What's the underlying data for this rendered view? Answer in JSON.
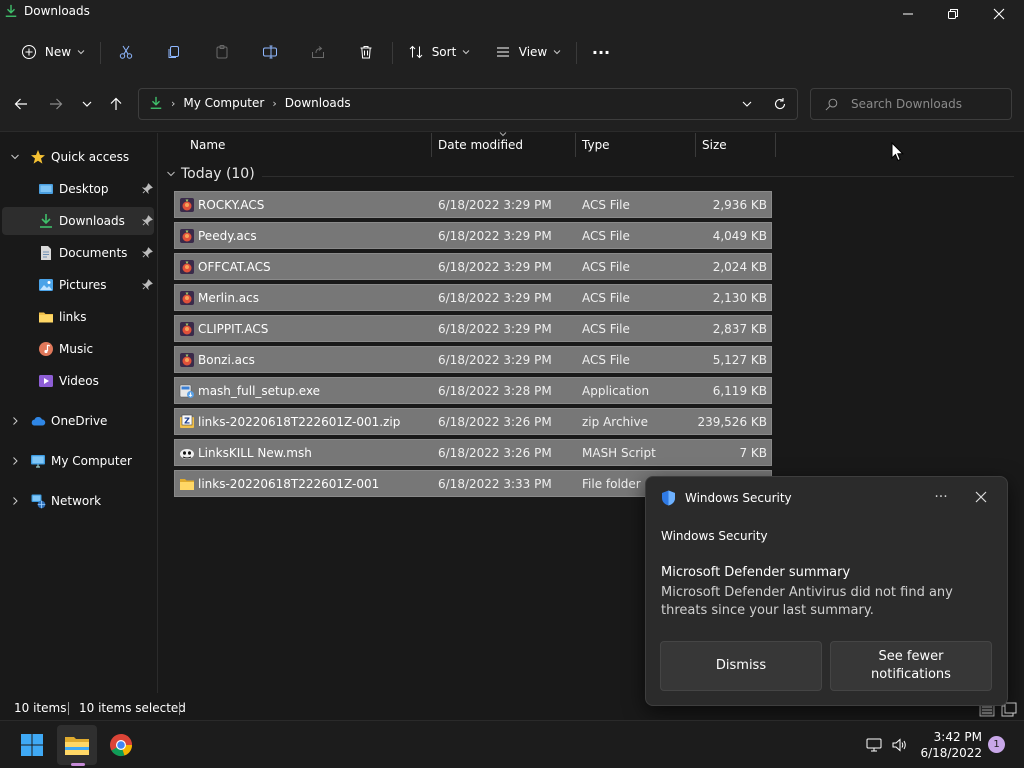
{
  "window": {
    "title": "Downloads"
  },
  "toolbar": {
    "new_label": "New",
    "sort_label": "Sort",
    "view_label": "View",
    "more_label": "···"
  },
  "address": {
    "crumbs": [
      "My Computer",
      "Downloads"
    ]
  },
  "search": {
    "placeholder": "Search Downloads"
  },
  "sidebar": {
    "items": [
      {
        "label": "Quick access"
      },
      {
        "label": "Desktop"
      },
      {
        "label": "Downloads"
      },
      {
        "label": "Documents"
      },
      {
        "label": "Pictures"
      },
      {
        "label": "links"
      },
      {
        "label": "Music"
      },
      {
        "label": "Videos"
      },
      {
        "label": "OneDrive"
      },
      {
        "label": "My Computer"
      },
      {
        "label": "Network"
      }
    ]
  },
  "columns": {
    "name": "Name",
    "date": "Date modified",
    "type": "Type",
    "size": "Size"
  },
  "group": {
    "label": "Today (10)"
  },
  "files": [
    {
      "name": "ROCKY.ACS",
      "date": "6/18/2022 3:29 PM",
      "type": "ACS File",
      "size": "2,936 KB",
      "icon": "acs-file-icon"
    },
    {
      "name": "Peedy.acs",
      "date": "6/18/2022 3:29 PM",
      "type": "ACS File",
      "size": "4,049 KB",
      "icon": "acs-file-icon"
    },
    {
      "name": "OFFCAT.ACS",
      "date": "6/18/2022 3:29 PM",
      "type": "ACS File",
      "size": "2,024 KB",
      "icon": "acs-file-icon"
    },
    {
      "name": "Merlin.acs",
      "date": "6/18/2022 3:29 PM",
      "type": "ACS File",
      "size": "2,130 KB",
      "icon": "acs-file-icon"
    },
    {
      "name": "CLIPPIT.ACS",
      "date": "6/18/2022 3:29 PM",
      "type": "ACS File",
      "size": "2,837 KB",
      "icon": "acs-file-icon"
    },
    {
      "name": "Bonzi.acs",
      "date": "6/18/2022 3:29 PM",
      "type": "ACS File",
      "size": "5,127 KB",
      "icon": "acs-file-icon"
    },
    {
      "name": "mash_full_setup.exe",
      "date": "6/18/2022 3:28 PM",
      "type": "Application",
      "size": "6,119 KB",
      "icon": "installer-icon"
    },
    {
      "name": "links-20220618T222601Z-001.zip",
      "date": "6/18/2022 3:26 PM",
      "type": "zip Archive",
      "size": "239,526 KB",
      "icon": "zip-archive-icon"
    },
    {
      "name": "LinksKILL New.msh",
      "date": "6/18/2022 3:26 PM",
      "type": "MASH Script",
      "size": "7 KB",
      "icon": "mash-script-icon"
    },
    {
      "name": "links-20220618T222601Z-001",
      "date": "6/18/2022 3:33 PM",
      "type": "File folder",
      "size": "",
      "icon": "folder-icon"
    }
  ],
  "status": {
    "items": "10 items",
    "selected": "10 items selected"
  },
  "toast": {
    "header": "Windows Security",
    "app": "Windows Security",
    "title": "Microsoft Defender summary",
    "body": "Microsoft Defender Antivirus did not find any threats since your last summary.",
    "dismiss": "Dismiss",
    "fewer_line1": "See fewer",
    "fewer_line2": "notifications",
    "more": "···"
  },
  "taskbar": {
    "time": "3:42 PM",
    "date": "6/18/2022",
    "notifications": "1"
  },
  "colors": {
    "accent_green": "#3fbf6a",
    "folder_yellow": "#f2c14b",
    "selection_gray": "#777777",
    "shield_blue": "#2f7ae5"
  }
}
